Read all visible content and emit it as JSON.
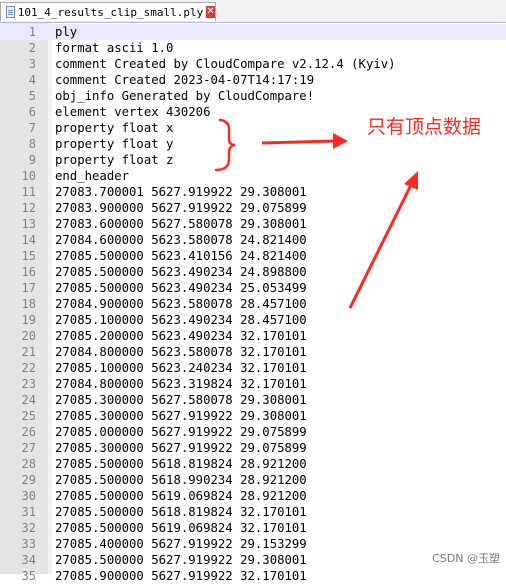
{
  "tab": {
    "title": "101_4_results_clip_small.ply",
    "close_glyph": "✕"
  },
  "lines": [
    {
      "n": "1",
      "text": "ply"
    },
    {
      "n": "2",
      "text": "format ascii 1.0"
    },
    {
      "n": "3",
      "text": "comment Created by CloudCompare v2.12.4 (Kyiv)"
    },
    {
      "n": "4",
      "text": "comment Created 2023-04-07T14:17:19"
    },
    {
      "n": "5",
      "text": "obj_info Generated by CloudCompare!"
    },
    {
      "n": "6",
      "text": "element vertex 430206"
    },
    {
      "n": "7",
      "text": "property float x"
    },
    {
      "n": "8",
      "text": "property float y"
    },
    {
      "n": "9",
      "text": "property float z"
    },
    {
      "n": "10",
      "text": "end_header"
    },
    {
      "n": "11",
      "text": "27083.700001 5627.919922 29.308001"
    },
    {
      "n": "12",
      "text": "27083.900000 5627.919922 29.075899"
    },
    {
      "n": "13",
      "text": "27083.600000 5627.580078 29.308001"
    },
    {
      "n": "14",
      "text": "27084.600000 5623.580078 24.821400"
    },
    {
      "n": "15",
      "text": "27085.500000 5623.410156 24.821400"
    },
    {
      "n": "16",
      "text": "27085.500000 5623.490234 24.898800"
    },
    {
      "n": "17",
      "text": "27085.500000 5623.490234 25.053499"
    },
    {
      "n": "18",
      "text": "27084.900000 5623.580078 28.457100"
    },
    {
      "n": "19",
      "text": "27085.100000 5623.490234 28.457100"
    },
    {
      "n": "20",
      "text": "27085.200000 5623.490234 32.170101"
    },
    {
      "n": "21",
      "text": "27084.800000 5623.580078 32.170101"
    },
    {
      "n": "22",
      "text": "27085.100000 5623.240234 32.170101"
    },
    {
      "n": "23",
      "text": "27084.800000 5623.319824 32.170101"
    },
    {
      "n": "24",
      "text": "27085.300000 5627.580078 29.308001"
    },
    {
      "n": "25",
      "text": "27085.300000 5627.919922 29.308001"
    },
    {
      "n": "26",
      "text": "27085.000000 5627.919922 29.075899"
    },
    {
      "n": "27",
      "text": "27085.300000 5627.919922 29.075899"
    },
    {
      "n": "28",
      "text": "27085.500000 5618.819824 28.921200"
    },
    {
      "n": "29",
      "text": "27085.500000 5618.990234 28.921200"
    },
    {
      "n": "30",
      "text": "27085.500000 5619.069824 28.921200"
    },
    {
      "n": "31",
      "text": "27085.500000 5618.819824 32.170101"
    },
    {
      "n": "32",
      "text": "27085.500000 5619.069824 32.170101"
    },
    {
      "n": "33",
      "text": "27085.400000 5627.919922 29.153299"
    },
    {
      "n": "34",
      "text": "27085.500000 5627.919922 29.308001"
    },
    {
      "n": "35",
      "text": "27085.900000 5627.919922 32.170101"
    }
  ],
  "current_line": 1,
  "annotation": {
    "text": "只有顶点数据",
    "color": "#ff2a1f"
  },
  "watermark": "CSDN @玉塑"
}
